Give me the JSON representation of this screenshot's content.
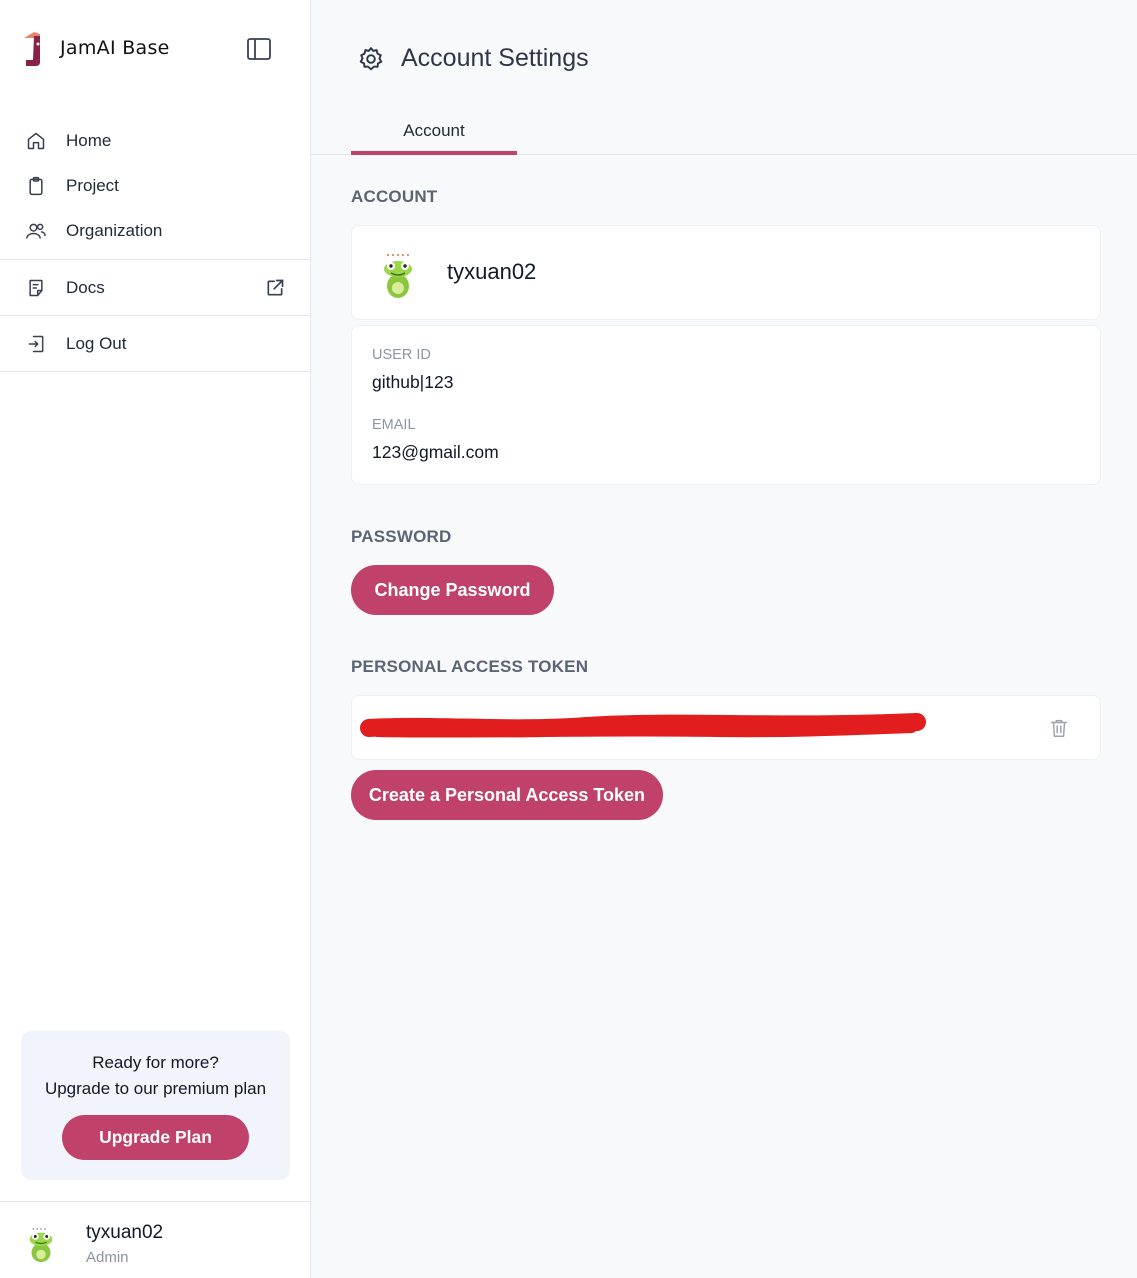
{
  "brand": {
    "name": "JamAI Base"
  },
  "nav": {
    "items": [
      {
        "label": "Home",
        "icon": "home-icon"
      },
      {
        "label": "Project",
        "icon": "clipboard-icon"
      },
      {
        "label": "Organization",
        "icon": "users-icon"
      }
    ],
    "docs": {
      "label": "Docs",
      "icon": "docs-icon",
      "ext_icon": "external-link-icon"
    },
    "logout": {
      "label": "Log Out",
      "icon": "logout-icon"
    }
  },
  "upgrade": {
    "line1": "Ready for more?",
    "line2": "Upgrade to our premium plan",
    "button": "Upgrade Plan"
  },
  "user": {
    "name": "tyxuan02",
    "role": "Admin"
  },
  "page": {
    "title": "Account Settings",
    "tab": "Account"
  },
  "account": {
    "section_label": "ACCOUNT",
    "username": "tyxuan02",
    "user_id_label": "USER ID",
    "user_id": "github|123",
    "email_label": "EMAIL",
    "email": "123@gmail.com"
  },
  "password": {
    "section_label": "PASSWORD",
    "button": "Change Password"
  },
  "token": {
    "section_label": "PERSONAL ACCESS TOKEN",
    "button": "Create a Personal Access Token"
  },
  "colors": {
    "accent": "#c0416a",
    "redaction": "#e11d1d"
  }
}
